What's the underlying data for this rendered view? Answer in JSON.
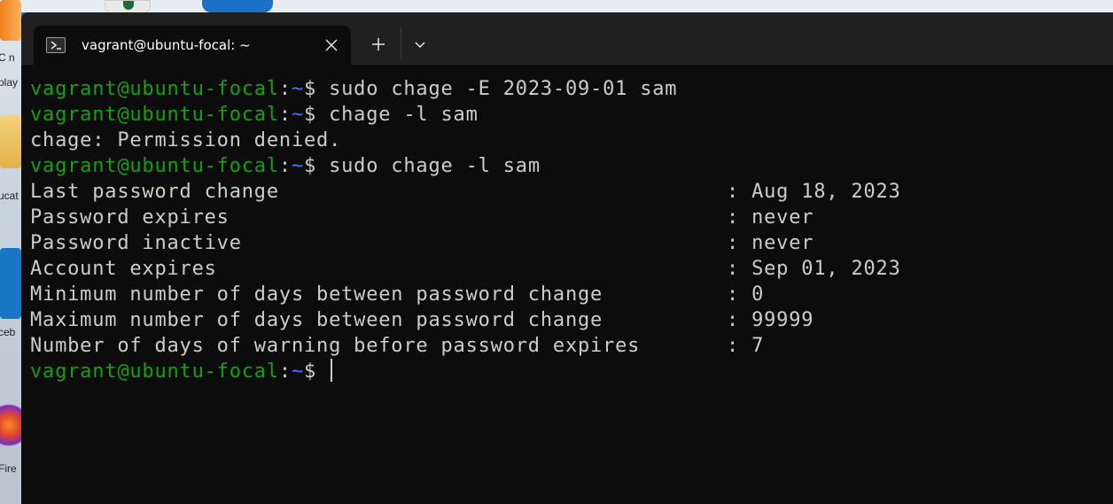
{
  "desktop": {
    "labels": [
      "C n",
      "play",
      "ucat",
      "ceb",
      "Fire"
    ]
  },
  "tab": {
    "title": "vagrant@ubuntu-focal: ~",
    "icon": "powershell-terminal-icon",
    "close_icon": "close-icon"
  },
  "tabbar": {
    "new_tab_icon": "plus-icon",
    "dropdown_icon": "chevron-down-icon"
  },
  "prompt": {
    "user_host": "vagrant@ubuntu-focal",
    "colon": ":",
    "path": "~",
    "symbol": "$ "
  },
  "lines": {
    "cmd1": "sudo chage -E 2023-09-01 sam",
    "cmd2": "chage -l sam",
    "err": "chage: Permission denied.",
    "cmd3": "sudo chage -l sam"
  },
  "chage_output": [
    {
      "label": "Last password change",
      "value": ": Aug 18, 2023"
    },
    {
      "label": "Password expires",
      "value": ": never"
    },
    {
      "label": "Password inactive",
      "value": ": never"
    },
    {
      "label": "Account expires",
      "value": ": Sep 01, 2023"
    },
    {
      "label": "Minimum number of days between password change",
      "value": ": 0"
    },
    {
      "label": "Maximum number of days between password change",
      "value": ": 99999"
    },
    {
      "label": "Number of days of warning before password expires",
      "value": ": 7"
    }
  ],
  "colors": {
    "prompt_user": "#13a10e",
    "prompt_path": "#3b78ff",
    "text": "#cccccc",
    "background": "#0c0c0c",
    "titlebar": "#202020"
  }
}
